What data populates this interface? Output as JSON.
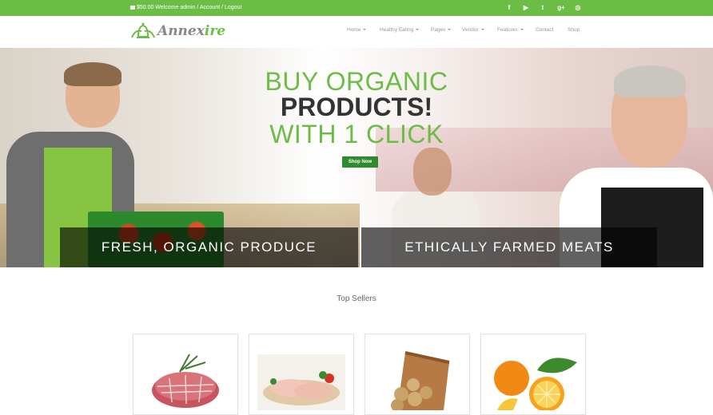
{
  "topbar": {
    "cart_text": "$50.00 Welcome admin / Account / Logout",
    "social": [
      {
        "icon": "facebook-icon",
        "glyph": "f"
      },
      {
        "icon": "youtube-icon",
        "glyph": "▶"
      },
      {
        "icon": "twitter-icon",
        "glyph": "t"
      },
      {
        "icon": "google-plus-icon",
        "glyph": "g+"
      },
      {
        "icon": "dribbble-icon",
        "glyph": "◎"
      }
    ]
  },
  "header": {
    "logo_text_1": "Annex",
    "logo_text_2": "ire",
    "nav": [
      {
        "label": "Home",
        "dropdown": true
      },
      {
        "label": "Healthy Eating",
        "dropdown": true
      },
      {
        "label": "Pages",
        "dropdown": true
      },
      {
        "label": "Vendor",
        "dropdown": true
      },
      {
        "label": "Features",
        "dropdown": true
      },
      {
        "label": "Contact",
        "dropdown": false
      },
      {
        "label": "Shop",
        "dropdown": false
      }
    ]
  },
  "hero": {
    "line1": "BUY ORGANIC",
    "line2": "PRODUCTS!",
    "line3": "WITH 1 CLICK",
    "cta": "Shop Now",
    "band_left": "FRESH, ORGANIC PRODUCE",
    "band_right": "ETHICALLY FARMED MEATS"
  },
  "top_sellers": {
    "title": "Top Sellers",
    "products": [
      {
        "image": "meat-roast-image"
      },
      {
        "image": "chicken-breast-image"
      },
      {
        "image": "potato-basket-image"
      },
      {
        "image": "oranges-image"
      }
    ]
  },
  "colors": {
    "brand_green": "#6cbd45",
    "button_green": "#2e8b2e"
  }
}
